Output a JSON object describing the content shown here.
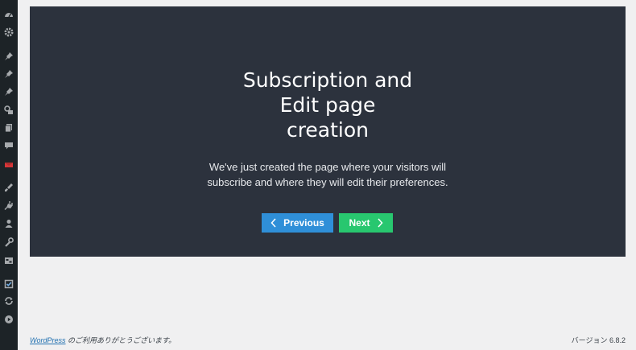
{
  "sidebar": {
    "items": [
      {
        "icon": "dashboard-icon"
      },
      {
        "icon": "gear-icon"
      },
      {
        "icon": "pin-icon"
      },
      {
        "icon": "pin-icon"
      },
      {
        "icon": "pin-icon"
      },
      {
        "icon": "media-icon"
      },
      {
        "icon": "pages-icon"
      },
      {
        "icon": "comments-icon"
      },
      {
        "icon": "email-icon",
        "color": "#d63638"
      },
      {
        "icon": "appearance-icon"
      },
      {
        "icon": "plugins-icon"
      },
      {
        "icon": "users-icon"
      },
      {
        "icon": "tools-icon"
      },
      {
        "icon": "settings-icon"
      },
      {
        "icon": "checkbox-icon"
      },
      {
        "icon": "sync-icon"
      },
      {
        "icon": "play-icon"
      }
    ]
  },
  "modal": {
    "title": "Subscription and\nEdit page\ncreation",
    "description": "We've just created the page where your visitors will subscribe and where they will edit their preferences.",
    "previous_label": "Previous",
    "next_label": "Next",
    "colors": {
      "background": "#2c323d",
      "previous": "#2f8fd8",
      "next": "#28c76f"
    }
  },
  "footer": {
    "link_text": "WordPress",
    "thanks_text": " のご利用ありがとうございます。",
    "version_text": "バージョン 6.8.2"
  }
}
